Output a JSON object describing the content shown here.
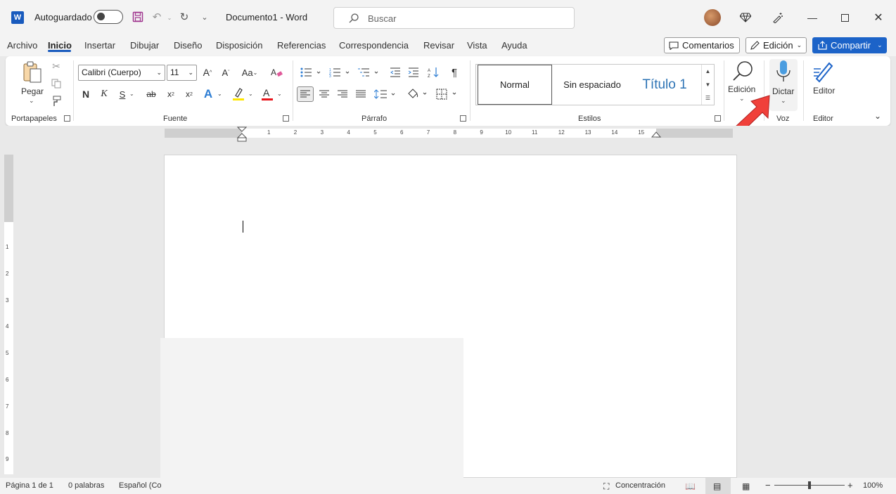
{
  "titlebar": {
    "autosave_label": "Autoguardado",
    "doc_title": "Documento1  -  Word",
    "search_placeholder": "Buscar"
  },
  "menu": {
    "tabs": [
      "Archivo",
      "Inicio",
      "Insertar",
      "Dibujar",
      "Diseño",
      "Disposición",
      "Referencias",
      "Correspondencia",
      "Revisar",
      "Vista",
      "Ayuda"
    ],
    "active_tab": "Inicio",
    "comments_label": "Comentarios",
    "editing_label": "Edición",
    "share_label": "Compartir"
  },
  "ribbon": {
    "clipboard": {
      "paste_label": "Pegar",
      "group_label": "Portapapeles"
    },
    "font": {
      "font_name": "Calibri (Cuerpo)",
      "font_size": "11",
      "group_label": "Fuente"
    },
    "paragraph": {
      "group_label": "Párrafo"
    },
    "styles": {
      "items": [
        "Normal",
        "Sin espaciado",
        "Título 1"
      ],
      "group_label": "Estilos"
    },
    "editing": {
      "label": "Edición"
    },
    "voice": {
      "dictate_label": "Dictar",
      "group_label": "Voz"
    },
    "editor": {
      "label": "Editor",
      "group_label": "Editor"
    }
  },
  "ruler": {
    "numbers": [
      "1",
      "2",
      "3",
      "4",
      "5",
      "6",
      "7",
      "8",
      "9",
      "10",
      "11",
      "12",
      "13",
      "14",
      "15"
    ],
    "vertical_numbers": [
      "1",
      "2",
      "3",
      "4",
      "5",
      "6",
      "7",
      "8",
      "9"
    ]
  },
  "statusbar": {
    "page": "Página 1 de 1",
    "words": "0 palabras",
    "language": "Español (Co",
    "focus": "Concentración",
    "zoom": "100%"
  },
  "colors": {
    "accent": "#185abd",
    "share_button": "#1c63c8",
    "title_style": "#2e74b5",
    "arrow": "#f0403a"
  }
}
